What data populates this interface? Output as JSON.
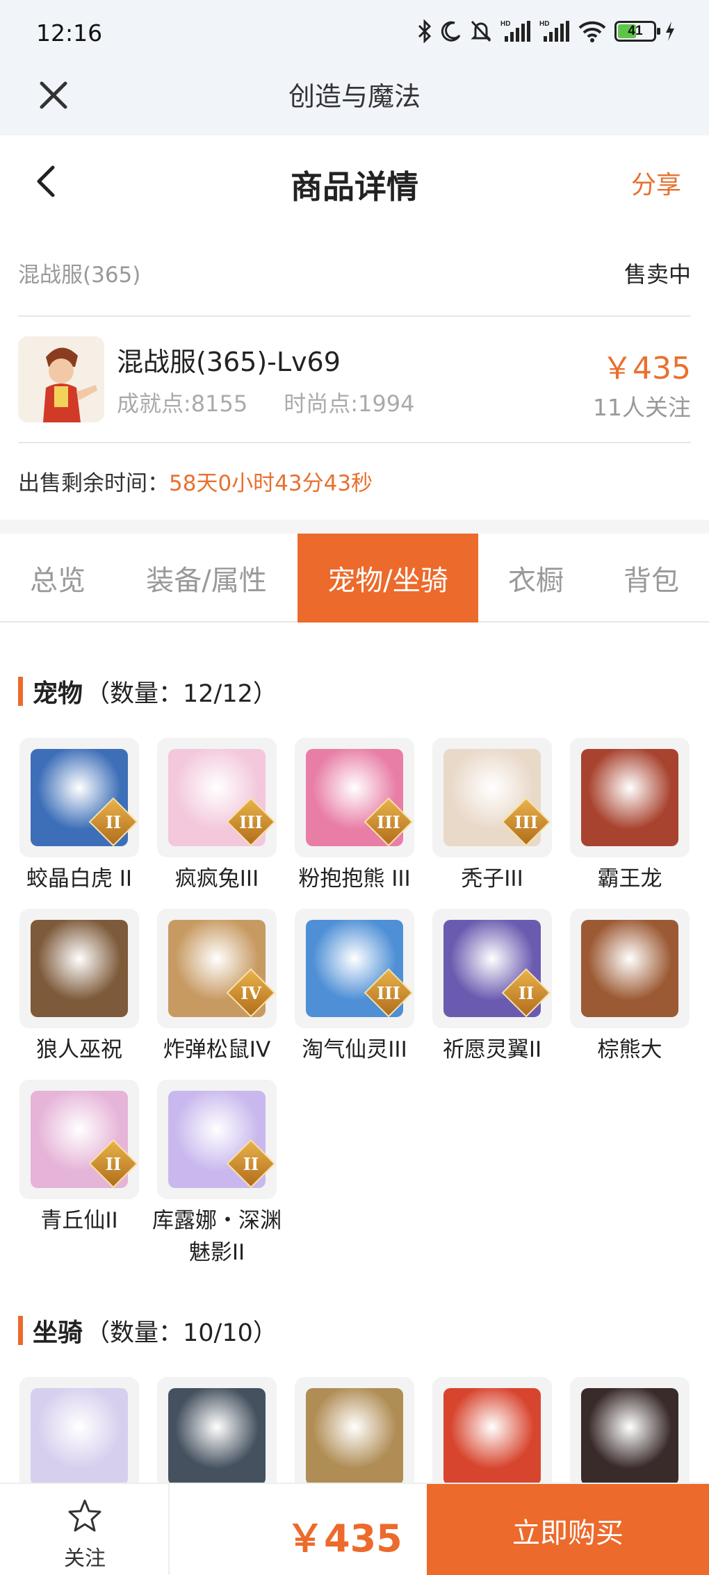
{
  "status_bar": {
    "time": "12:16",
    "battery": "41",
    "icons": [
      "bluetooth-icon",
      "moon-icon",
      "mute-icon",
      "signal-hd-icon",
      "signal-hd-icon",
      "wifi-icon",
      "battery-icon",
      "charging-icon"
    ]
  },
  "app_bar": {
    "title": "创造与魔法",
    "close_icon": "close-icon"
  },
  "header": {
    "title": "商品详情",
    "share_label": "分享",
    "back_icon": "chevron-left-icon"
  },
  "server": {
    "name": "混战服(365)",
    "status": "售卖中"
  },
  "product": {
    "name": "混战服(365)-Lv69",
    "achievement": "成就点:8155",
    "fashion": "时尚点:1994",
    "price": "￥435",
    "followers": "11人关注"
  },
  "remaining": {
    "label": "出售剩余时间：",
    "value": "58天0小时43分43秒"
  },
  "tabs": [
    {
      "label": "总览",
      "active": false
    },
    {
      "label": "装备/属性",
      "active": false
    },
    {
      "label": "宠物/坐骑",
      "active": true
    },
    {
      "label": "衣橱",
      "active": false
    },
    {
      "label": "背包",
      "active": false
    }
  ],
  "pets": {
    "title": "宠物",
    "count": "（数量：12/12）",
    "items": [
      {
        "name": "蛟晶白虎 II",
        "tier": "II",
        "color": "#3d6fb8"
      },
      {
        "name": "疯疯兔III",
        "tier": "III",
        "color": "#f3c8dc"
      },
      {
        "name": "粉抱抱熊 III",
        "tier": "III",
        "color": "#e87ea6"
      },
      {
        "name": "秃子III",
        "tier": "III",
        "color": "#e9d9c9"
      },
      {
        "name": "霸王龙",
        "tier": "",
        "color": "#a8432f"
      },
      {
        "name": "狼人巫祝",
        "tier": "",
        "color": "#7d5a3a"
      },
      {
        "name": "炸弹松鼠IV",
        "tier": "IV",
        "color": "#c79a62"
      },
      {
        "name": "淘气仙灵III",
        "tier": "III",
        "color": "#4e8fd6"
      },
      {
        "name": "祈愿灵翼II",
        "tier": "II",
        "color": "#6b5bb0"
      },
      {
        "name": "棕熊大",
        "tier": "",
        "color": "#9c5a34"
      },
      {
        "name": "青丘仙II",
        "tier": "II",
        "color": "#e6b4d8"
      },
      {
        "name": "库露娜・深渊魅影II",
        "tier": "II",
        "color": "#c9b8ee"
      }
    ]
  },
  "mounts": {
    "title": "坐骑",
    "count": "（数量：10/10）",
    "items": [
      {
        "color": "#d7cfee"
      },
      {
        "color": "#45515f"
      },
      {
        "color": "#b08d55"
      },
      {
        "color": "#d8452e"
      },
      {
        "color": "#3a2b2b"
      }
    ]
  },
  "bottom": {
    "follow_label": "关注",
    "price": "￥435",
    "buy_label": "立即购买"
  },
  "colors": {
    "accent": "#ec6a2b",
    "price": "#e8702e"
  }
}
